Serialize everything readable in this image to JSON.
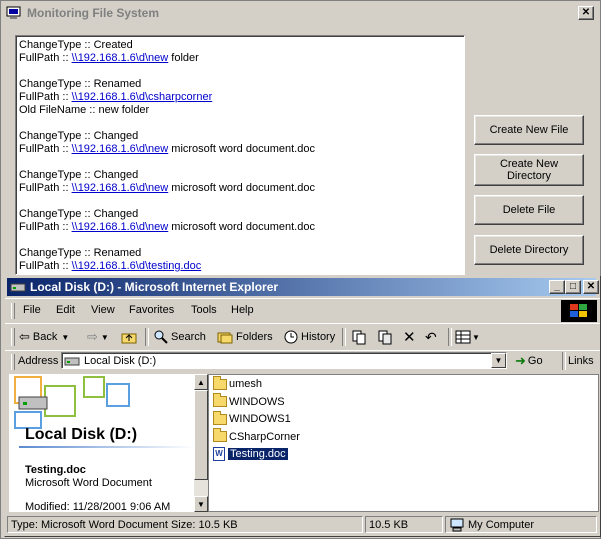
{
  "monitor": {
    "title": "Monitoring File System",
    "close_glyph": "✕",
    "log": [
      {
        "lines": [
          {
            "text": "ChangeType :: Created"
          },
          {
            "prefix": "FullPath :: ",
            "link": "\\\\192.168.1.6\\d\\new",
            "suffix": " folder"
          }
        ]
      },
      {
        "lines": [
          {
            "text": "ChangeType :: Renamed"
          },
          {
            "prefix": "FullPath :: ",
            "link": "\\\\192.168.1.6\\d\\csharpcorner",
            "suffix": ""
          },
          {
            "text": "Old FileName :: new folder"
          }
        ]
      },
      {
        "lines": [
          {
            "text": "ChangeType :: Changed"
          },
          {
            "prefix": "FullPath :: ",
            "link": "\\\\192.168.1.6\\d\\new",
            "suffix": " microsoft word document.doc"
          }
        ]
      },
      {
        "lines": [
          {
            "text": "ChangeType :: Changed"
          },
          {
            "prefix": "FullPath :: ",
            "link": "\\\\192.168.1.6\\d\\new",
            "suffix": " microsoft word document.doc"
          }
        ]
      },
      {
        "lines": [
          {
            "text": "ChangeType :: Changed"
          },
          {
            "prefix": "FullPath :: ",
            "link": "\\\\192.168.1.6\\d\\new",
            "suffix": " microsoft word document.doc"
          }
        ]
      },
      {
        "lines": [
          {
            "text": "ChangeType :: Renamed"
          },
          {
            "prefix": "FullPath :: ",
            "link": "\\\\192.168.1.6\\d\\testing.doc",
            "suffix": ""
          }
        ]
      }
    ],
    "buttons": {
      "create_file": "Create New File",
      "create_dir_line1": "Create New",
      "create_dir_line2": "Directory",
      "delete_file": "Delete File",
      "delete_dir": "Delete Directory"
    }
  },
  "explorer": {
    "title": "Local Disk (D:) - Microsoft Internet Explorer",
    "window_controls": {
      "minimize": "_",
      "maximize": "□",
      "close": "✕"
    },
    "menu": [
      "File",
      "Edit",
      "View",
      "Favorites",
      "Tools",
      "Help"
    ],
    "toolbar": {
      "back": "Back",
      "search": "Search",
      "folders": "Folders",
      "history": "History"
    },
    "address": {
      "label": "Address",
      "value": "Local Disk (D:)",
      "go": "Go",
      "links": "Links"
    },
    "left_pane": {
      "heading": "Local Disk (D:)",
      "selected_name": "Testing.doc",
      "selected_type": "Microsoft Word Document",
      "modified": "Modified: 11/28/2001 9:06 AM"
    },
    "files": [
      {
        "name": "umesh",
        "kind": "folder"
      },
      {
        "name": "WINDOWS",
        "kind": "folder"
      },
      {
        "name": "WINDOWS1",
        "kind": "folder"
      },
      {
        "name": "CSharpCorner",
        "kind": "folder"
      },
      {
        "name": "Testing.doc",
        "kind": "doc",
        "selected": true
      }
    ],
    "status": {
      "main": "Type: Microsoft Word Document Size: 10.5 KB",
      "size": "10.5 KB",
      "zone": "My Computer"
    }
  }
}
